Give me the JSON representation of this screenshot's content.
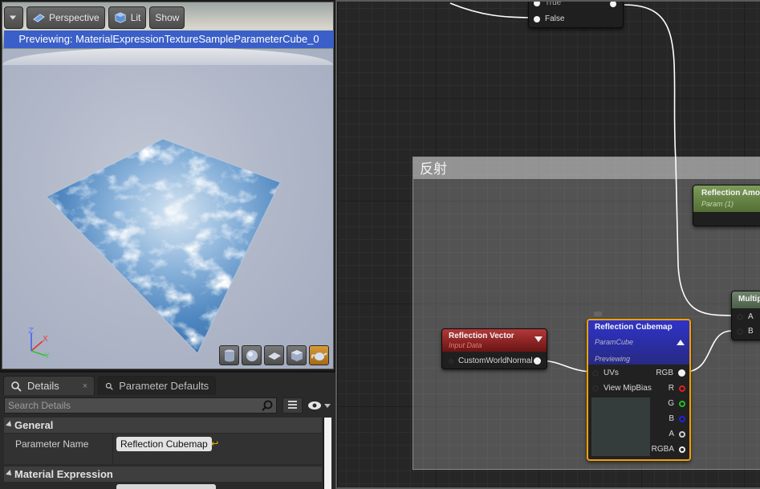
{
  "viewport": {
    "toolbar": {
      "menu_icon": "chevron-down-icon",
      "perspective_label": "Perspective",
      "lit_label": "Lit",
      "show_label": "Show"
    },
    "preview_banner": "Previewing: MaterialExpressionTextureSampleParameterCube_0",
    "axis": {
      "z": "Z",
      "x": "X",
      "y": "Y"
    },
    "preview_shapes": [
      "cylinder-icon",
      "sphere-icon",
      "plane-icon",
      "cube-icon",
      "teapot-icon"
    ]
  },
  "details": {
    "tabs": [
      {
        "label": "Details",
        "close": "×"
      },
      {
        "label": "Parameter Defaults"
      }
    ],
    "search_placeholder": "Search Details",
    "sections": {
      "general": "General",
      "material_expression": "Material Expression"
    },
    "properties": [
      {
        "name": "Parameter Name",
        "value": "Reflection Cubemap"
      }
    ]
  },
  "graph": {
    "comment_title": "反射",
    "nodes": {
      "switch": {
        "pins": [
          "True",
          "False"
        ]
      },
      "reflection_amount": {
        "title": "Reflection Amount",
        "subtitle": "Param (1)"
      },
      "multiply": {
        "title": "Multiply",
        "pins": [
          "A",
          "B"
        ]
      },
      "reflection_vector": {
        "title": "Reflection Vector",
        "subtitle": "Input Data",
        "output": "CustomWorldNormal"
      },
      "reflection_cubemap": {
        "title": "Reflection Cubemap",
        "subtitle": "ParamCube",
        "status": "Previewing",
        "inputs": [
          "UVs",
          "View MipBias"
        ],
        "outputs": [
          "RGB",
          "R",
          "G",
          "B",
          "A",
          "RGBA"
        ]
      }
    },
    "colors": {
      "selected_border": "#f5a000",
      "header_cube": "#2f34c9",
      "header_vector": "#b33838",
      "header_param": "#7d9b59",
      "pin_r": "#e02020",
      "pin_g": "#20c020",
      "pin_b": "#2020e0"
    }
  }
}
